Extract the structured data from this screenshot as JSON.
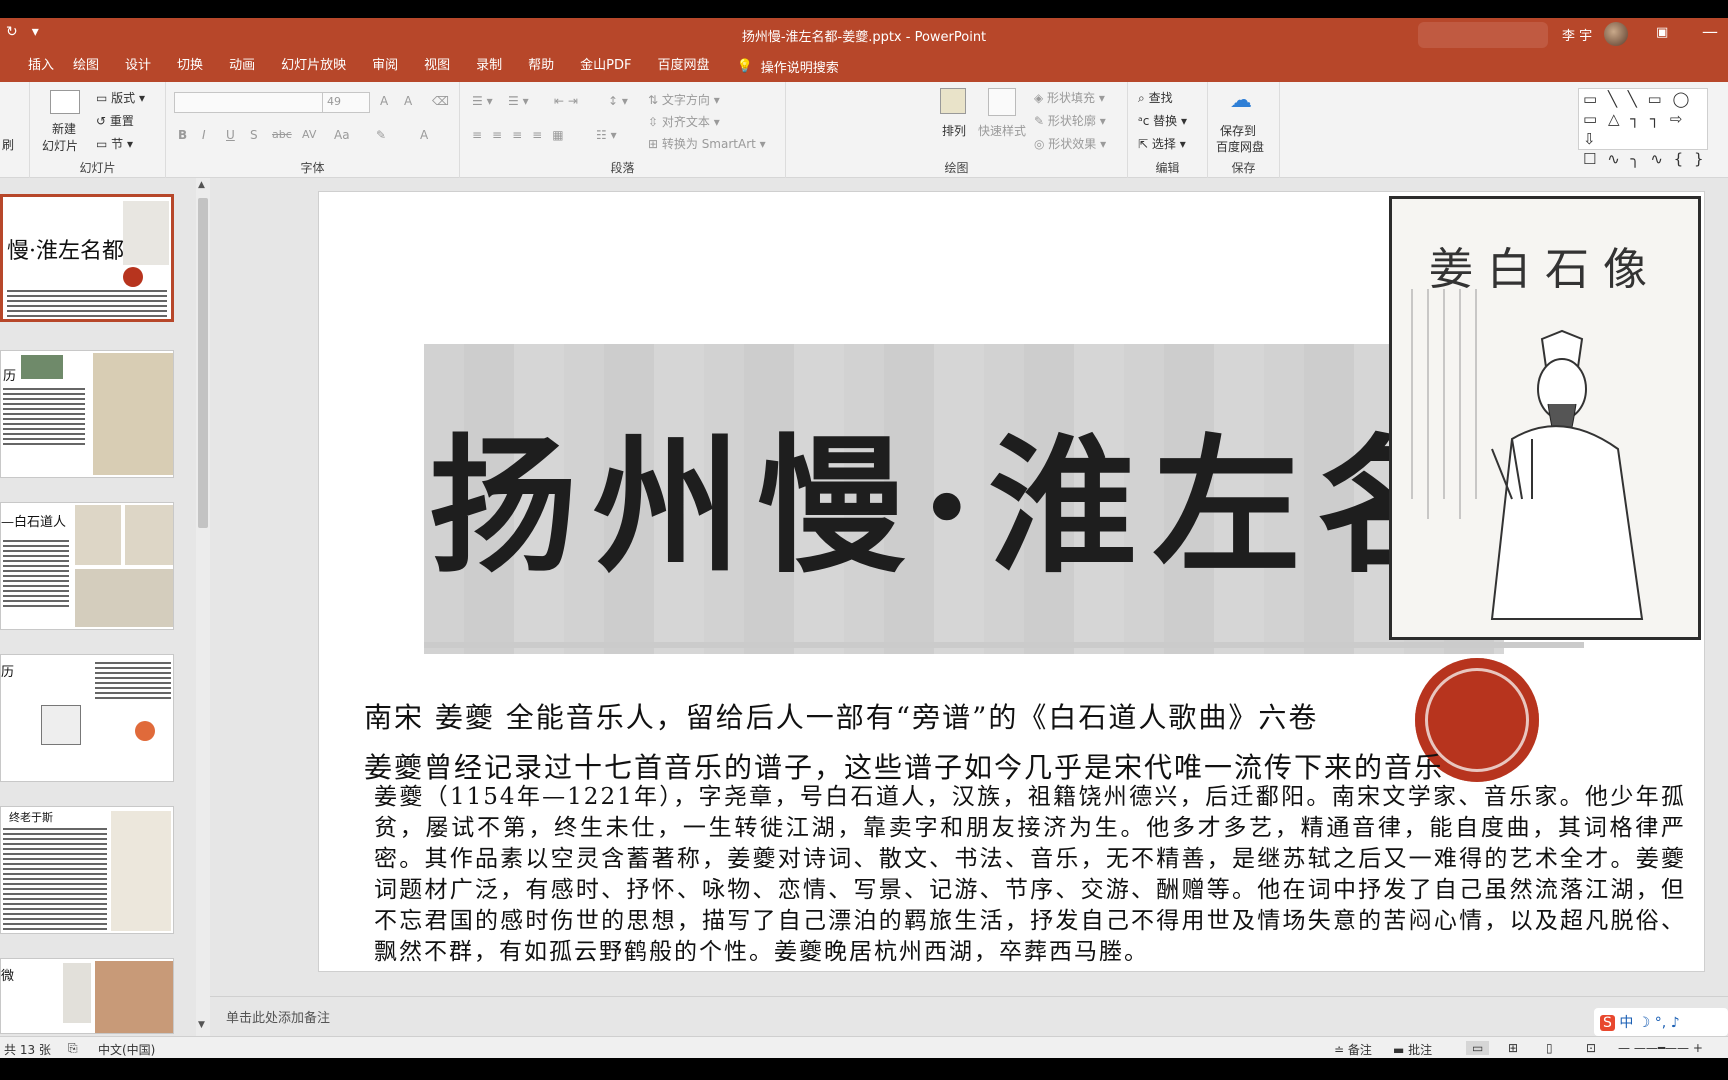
{
  "window": {
    "title": "扬州慢-淮左名都-姜夔.pptx  -  PowerPoint",
    "user": "李 宇",
    "ribbon_display_icon": "ribbon-display-options-icon",
    "minimize_icon": "minimize-icon"
  },
  "quick_access": {
    "icons": [
      "save-icon",
      "redo-icon",
      "customize-icon"
    ],
    "redo_glyph": "↻",
    "more_glyph": "▾"
  },
  "tabs": [
    "插入",
    "绘图",
    "设计",
    "切换",
    "动画",
    "幻灯片放映",
    "审阅",
    "视图",
    "录制",
    "帮助",
    "金山PDF",
    "百度网盘"
  ],
  "tell_me": "操作说明搜索",
  "ribbon": {
    "slides": {
      "label": "幻灯片",
      "new_slide_1": "新建",
      "new_slide_2": "幻灯片",
      "layout": "版式",
      "reset": "重置",
      "section": "节",
      "clipboard_fragment": "刷"
    },
    "font": {
      "label": "字体",
      "font_size": "49",
      "bold": "B",
      "italic": "I",
      "underline": "U",
      "shadow": "S",
      "strike": "abc",
      "spacing": "AV",
      "case": "Aa",
      "grow": "A",
      "shrink": "A",
      "color": "A"
    },
    "paragraph": {
      "label": "段落",
      "text_direction": "文字方向",
      "align_text": "对齐文本",
      "smartart": "转换为 SmartArt"
    },
    "drawing": {
      "label": "绘图",
      "arrange": "排列",
      "quick_styles": "快速样式",
      "shape_fill": "形状填充",
      "shape_outline": "形状轮廓",
      "shape_effects": "形状效果",
      "shapes_row1": "▭ ╲ ╲ ▭ ◯",
      "shapes_row2": "▭ △ ┐ ┐ ⇨ ⇩",
      "shapes_row3": "☐ ∿ ╮ ∿ { }"
    },
    "editing": {
      "label": "编辑",
      "find": "查找",
      "replace": "替换",
      "select": "选择"
    },
    "save": {
      "label": "保存",
      "save_to_1": "保存到",
      "save_to_2": "百度网盘"
    }
  },
  "thumbnails": [
    {
      "text": "慢·淮左名都",
      "active": true
    },
    {
      "text": "历",
      "active": false
    },
    {
      "text": "—白石道人",
      "active": false
    },
    {
      "text": "历",
      "active": false
    },
    {
      "text": "终老于斯",
      "active": false
    },
    {
      "text": "微",
      "active": false
    }
  ],
  "slide": {
    "title": "扬州慢·淮左名都",
    "portrait_caption": "姜白石像",
    "line1": "南宋 姜夔  全能音乐人，留给后人一部有“旁谱”的《白石道人歌曲》六卷",
    "line2": "姜夔曾经记录过十七首音乐的谱子，这些谱子如今几乎是宋代唯一流传下来的音乐",
    "bio": "姜夔（1154年—1221年），字尧章，号白石道人，汉族，祖籍饶州德兴，后迁鄱阳。南宋文学家、音乐家。他少年孤贫，屡试不第，终生未仕，一生转徙江湖，靠卖字和朋友接济为生。他多才多艺，精通音律，能自度曲，其词格律严密。其作品素以空灵含蓄著称，姜夔对诗词、散文、书法、音乐，无不精善，是继苏轼之后又一难得的艺术全才。姜夔词题材广泛，有感时、抒怀、咏物、恋情、写景、记游、节序、交游、酬赠等。他在词中抒发了自己虽然流落江湖，但不忘君国的感时伤世的思想，描写了自己漂泊的羁旅生活，抒发自己不得用世及情场失意的苦闷心情，以及超凡脱俗、飘然不群，有如孤云野鹤般的个性。姜夔晚居杭州西湖，卒葬西马塍。"
  },
  "notes_placeholder": "单击此处添加备注",
  "ime": "中 ☽ °, ♪",
  "status": {
    "slide_count": "共 13 张",
    "language": "中文(中国)",
    "notes": "备注",
    "comments": "批注"
  }
}
